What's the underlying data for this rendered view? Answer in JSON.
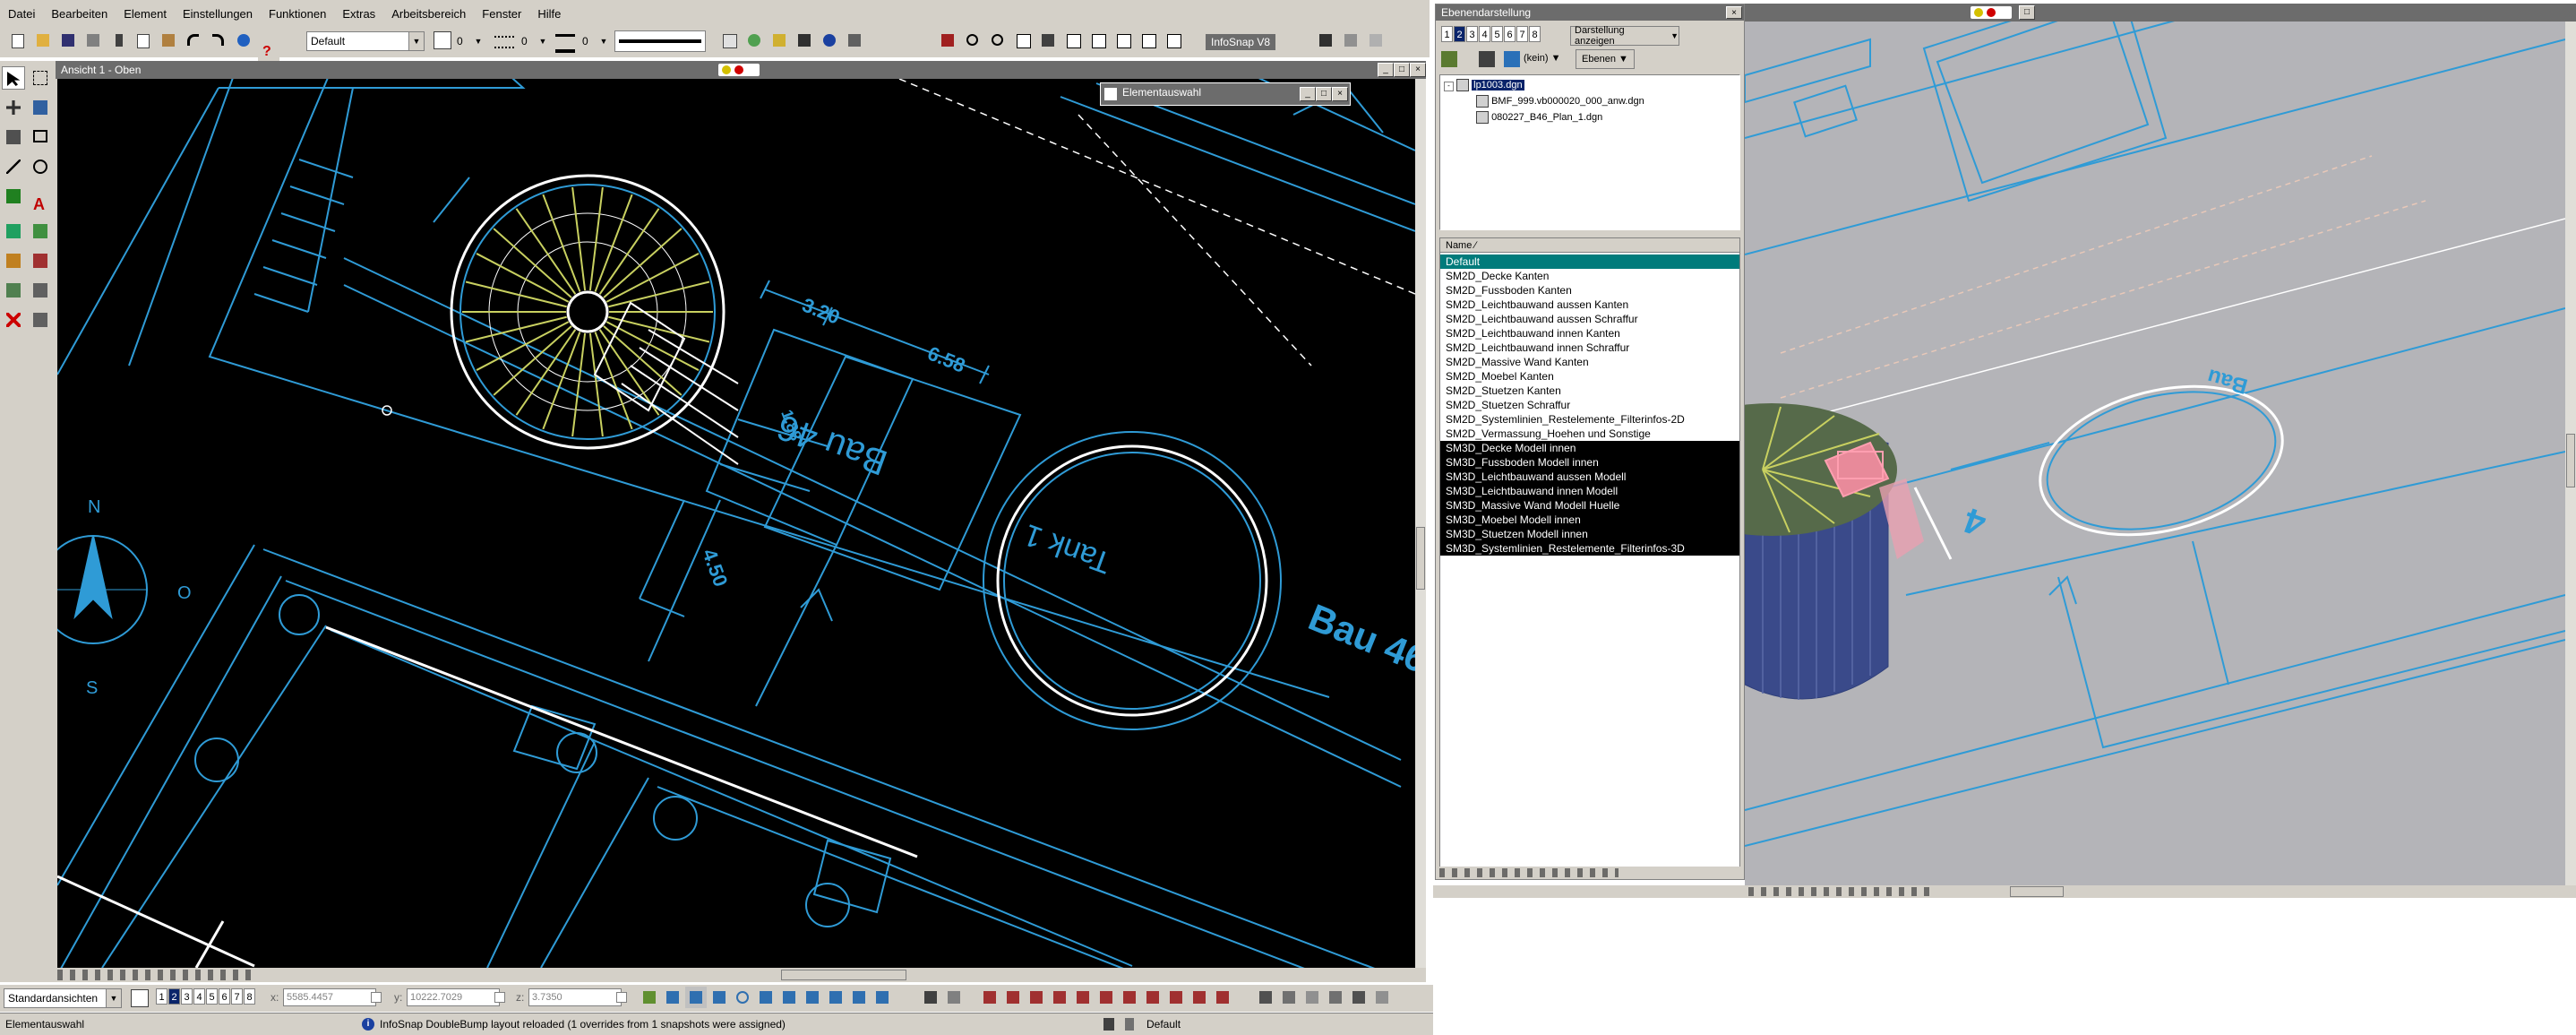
{
  "menu": [
    "Datei",
    "Bearbeiten",
    "Element",
    "Einstellungen",
    "Funktionen",
    "Extras",
    "Arbeitsbereich",
    "Fenster",
    "Hilfe"
  ],
  "toolbar": {
    "style_value": "Default",
    "color_value": "0",
    "linestyle_value": "0",
    "weight_value": "0",
    "infosnap_label": "InfoSnap V8"
  },
  "view1": {
    "title": "Ansicht 1 - Oben"
  },
  "cad": {
    "dim_320": "3.20",
    "dim_658": "6.58",
    "dim_450": "4.50",
    "dim_inner": "1.88",
    "building": "Bau 46",
    "building_big": "Bau 46",
    "tank": "Tank 1",
    "north": "N",
    "east": "O",
    "south": "S"
  },
  "element_selection": {
    "title": "Elementauswahl"
  },
  "level_panel": {
    "title": "Ebenendarstellung",
    "view_numbers": [
      "1",
      "2",
      "3",
      "4",
      "5",
      "6",
      "7",
      "8"
    ],
    "selected_view": "2",
    "display_dropdown": "Darstellung anzeigen",
    "filter_value": "(kein)",
    "ebenen_button": "Ebenen",
    "tree": {
      "root": "lp1003.dgn",
      "children": [
        "BMF_999.vb000020_000_anw.dgn",
        "080227_B46_Plan_1.dgn"
      ]
    },
    "column_name": "Name",
    "levels": [
      "Default",
      "SM2D_Decke Kanten",
      "SM2D_Fussboden Kanten",
      "SM2D_Leichtbauwand aussen Kanten",
      "SM2D_Leichtbauwand aussen Schraffur",
      "SM2D_Leichtbauwand innen Kanten",
      "SM2D_Leichtbauwand innen Schraffur",
      "SM2D_Massive Wand Kanten",
      "SM2D_Moebel Kanten",
      "SM2D_Stuetzen Kanten",
      "SM2D_Stuetzen Schraffur",
      "SM2D_Systemlinien_Restelemente_Filterinfos-2D",
      "SM2D_Vermassung_Hoehen und Sonstige",
      "SM3D_Decke Modell innen",
      "SM3D_Fussboden Modell innen",
      "SM3D_Leichtbauwand aussen Modell",
      "SM3D_Leichtbauwand innen Modell",
      "SM3D_Massive Wand Modell Huelle",
      "SM3D_Moebel Modell innen",
      "SM3D_Stuetzen Modell innen",
      "SM3D_Systemlinien_Restelemente_Filterinfos-3D"
    ]
  },
  "view2": {
    "label_bau": "Bau"
  },
  "bottom": {
    "view_combo": "Standardansichten",
    "view_numbers": [
      "1",
      "2",
      "3",
      "4",
      "5",
      "6",
      "7",
      "8"
    ],
    "x_label": "x:",
    "x_value": "5585.4457",
    "y_label": "y:",
    "y_value": "10222.7029",
    "z_label": "z:",
    "z_value": "3.7350"
  },
  "statusbar": {
    "left": "Elementauswahl",
    "message": "InfoSnap DoubleBump layout reloaded (1 overrides from 1 snapshots were assigned)",
    "level": "Default"
  },
  "colors": {
    "cad_bg": "#000000",
    "cad_blue": "#2f9bd6",
    "cad_white": "#ffffff",
    "stair_yellow": "#c8d060",
    "select_teal": "#007b7b",
    "render_bg": "#b4b4b8"
  }
}
